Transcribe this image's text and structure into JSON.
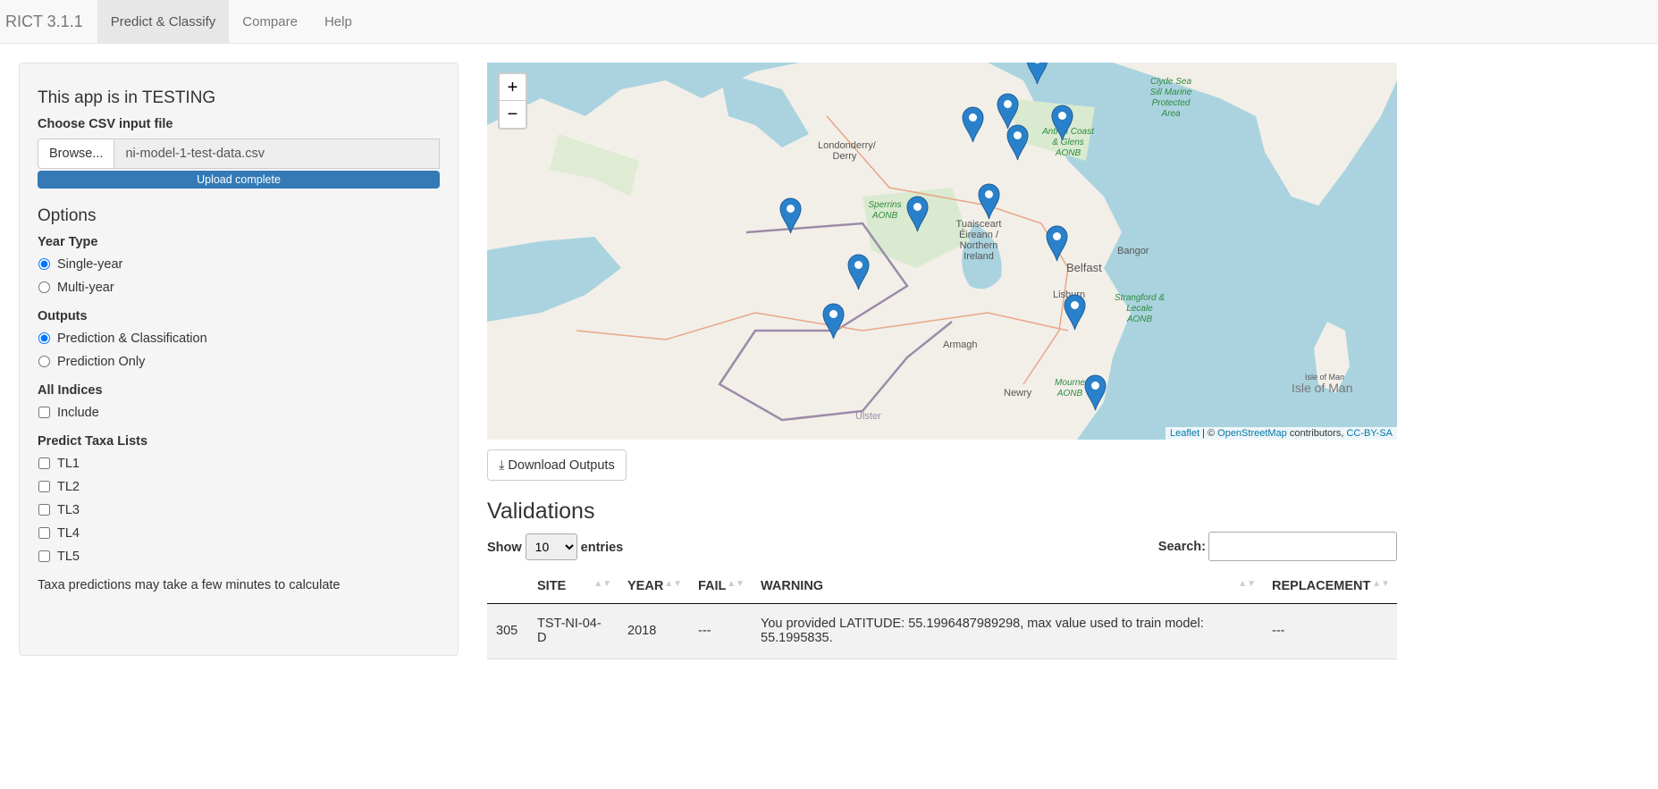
{
  "navbar": {
    "brand": "RICT 3.1.1",
    "tabs": [
      {
        "label": "Predict & Classify",
        "active": true
      },
      {
        "label": "Compare"
      },
      {
        "label": "Help"
      }
    ]
  },
  "sidebar": {
    "title": "This app is in TESTING",
    "file_label": "Choose CSV input file",
    "browse_label": "Browse...",
    "file_name": "ni-model-1-test-data.csv",
    "upload_status": "Upload complete",
    "upload_progress": 100,
    "options_title": "Options",
    "year_type": {
      "label": "Year Type",
      "options": [
        "Single-year",
        "Multi-year"
      ],
      "selected": "Single-year"
    },
    "outputs": {
      "label": "Outputs",
      "options": [
        "Prediction & Classification",
        "Prediction Only"
      ],
      "selected": "Prediction & Classification"
    },
    "all_indices": {
      "label": "All Indices",
      "option": "Include",
      "checked": false
    },
    "taxa": {
      "label": "Predict Taxa Lists",
      "options": [
        "TL1",
        "TL2",
        "TL3",
        "TL4",
        "TL5"
      ]
    },
    "note": "Taxa predictions may take a few minutes to calculate"
  },
  "map": {
    "zoom_in": "+",
    "zoom_out": "−",
    "labels": {
      "londonderry": "Londonderry/ Derry",
      "sperrins": "Sperrins AONB",
      "ni": "Tuaisceart Éireann / Northern Ireland",
      "belfast": "Belfast",
      "bangor": "Bangor",
      "lisburn": "Lisburn",
      "armagh": "Armagh",
      "newry": "Newry",
      "ulster": "Ulster",
      "antrim": "Antrim Coast & Glens AONB",
      "clyde": "Clyde Sea Sill Marine Protected Area",
      "strangford": "Strangford & Lecale AONB",
      "mourne": "Mourne AONB",
      "iom_small": "Isle of Man",
      "iom": "Isle of Man"
    },
    "attribution": {
      "leaflet": "Leaflet",
      "sep": " | © ",
      "osm": "OpenStreetMap",
      "contrib": " contributors, ",
      "license": "CC-BY-SA"
    },
    "marker_color": "#2a81cb"
  },
  "main": {
    "download_label": "Download Outputs",
    "section_title": "Validations",
    "show": "Show",
    "entries_value": "10",
    "entries": "entries",
    "search_label": "Search:",
    "columns": [
      "",
      "SITE",
      "YEAR",
      "FAIL",
      "WARNING",
      "REPLACEMENT"
    ],
    "rows": [
      {
        "id": "305",
        "site": "TST-NI-04-D",
        "year": "2018",
        "fail": "---",
        "warning": "You provided LATITUDE: 55.1996487989298, max value used to train model: 55.1995835.",
        "replacement": "---"
      }
    ]
  }
}
